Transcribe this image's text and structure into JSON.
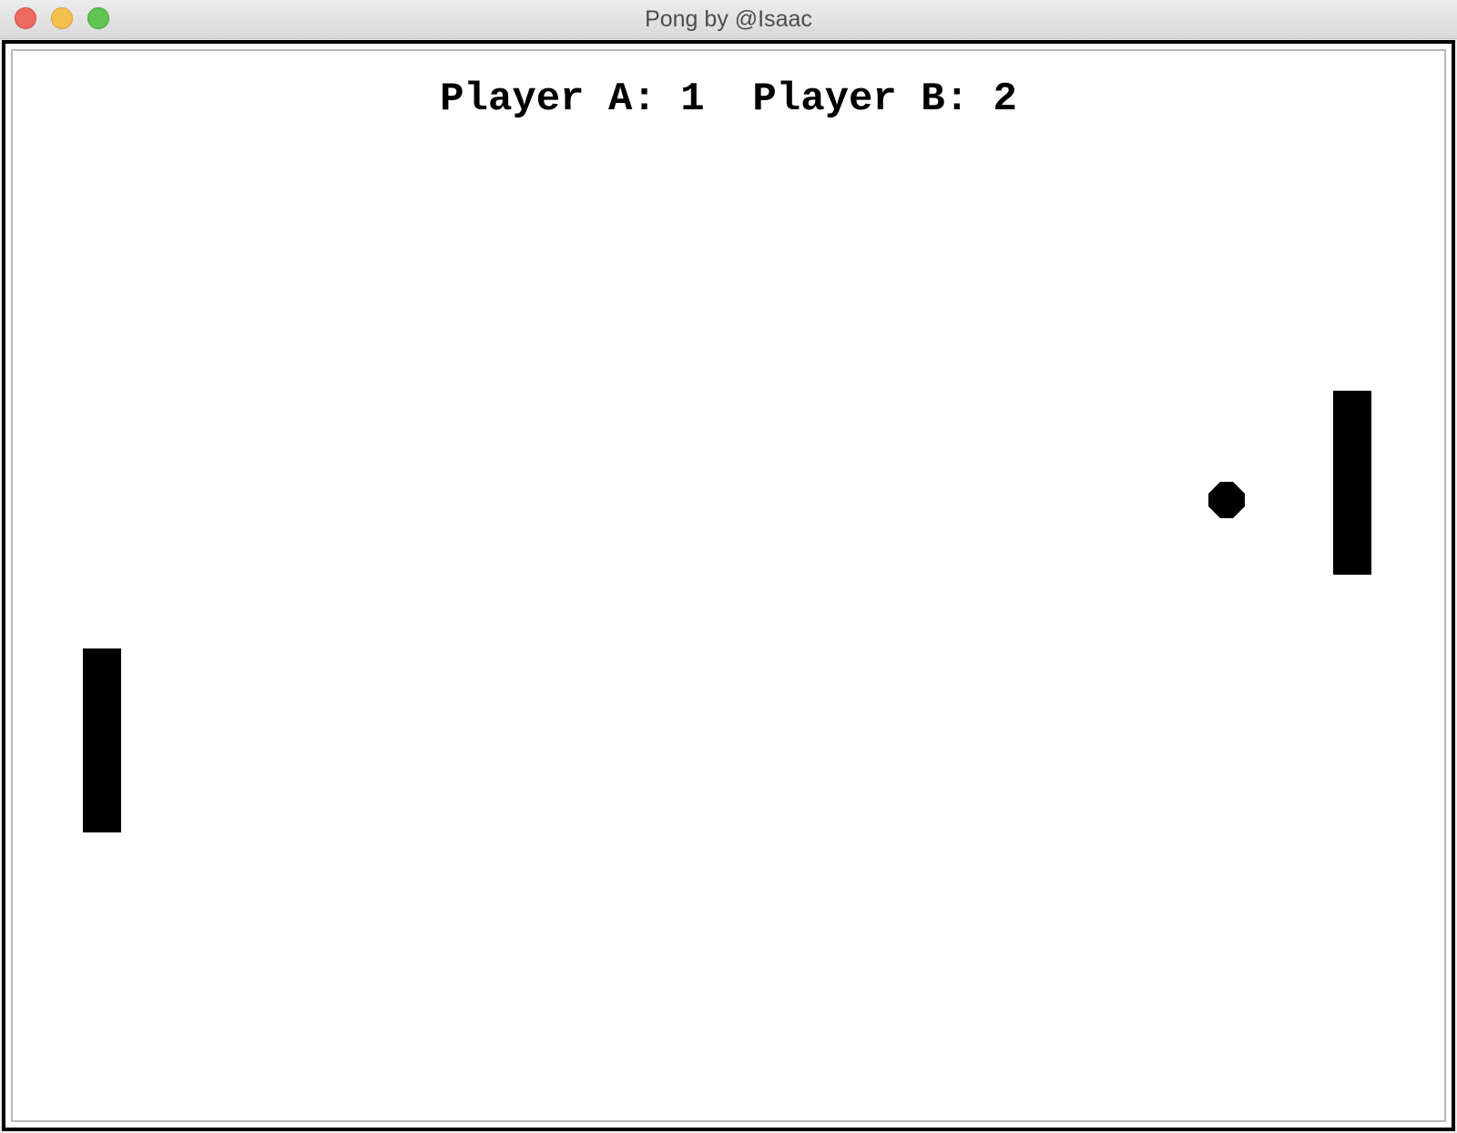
{
  "window": {
    "title": "Pong by @Isaac"
  },
  "score": {
    "player_a_label": "Player A:",
    "player_a_score": "1",
    "player_b_label": "Player B:",
    "player_b_score": "2"
  },
  "colors": {
    "background": "#ffffff",
    "foreground": "#000000",
    "close": "#ed6a5e",
    "minimize": "#f5bf4f",
    "zoom": "#61c554"
  },
  "icons": {
    "close": "close-icon",
    "minimize": "minimize-icon",
    "zoom": "zoom-icon"
  }
}
